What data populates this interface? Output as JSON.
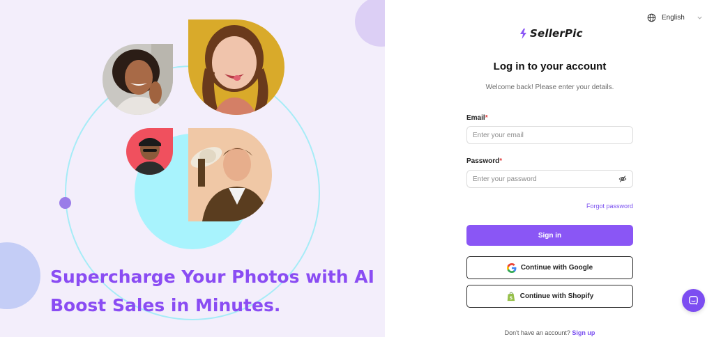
{
  "hero": {
    "headline_line1": "Supercharge Your Photos with AI",
    "headline_line2": "Boost Sales in Minutes."
  },
  "language": {
    "icon": "globe-icon",
    "selected": "English"
  },
  "brand": {
    "name": "SellerPic",
    "icon": "bolt-logo-icon",
    "accent": "#8a56f5"
  },
  "form": {
    "title": "Log in to your account",
    "subtitle": "Welcome back! Please enter your details.",
    "email_label": "Email",
    "email_placeholder": "Enter your email",
    "password_label": "Password",
    "password_placeholder": "Enter your password",
    "required_mark": "*",
    "forgot_password": "Forgot password",
    "sign_in": "Sign in",
    "google": "Continue with Google",
    "shopify": "Continue with Shopify",
    "no_account": "Don't have an account?",
    "sign_up": "Sign up"
  },
  "chat": {
    "icon": "chat-icon"
  }
}
